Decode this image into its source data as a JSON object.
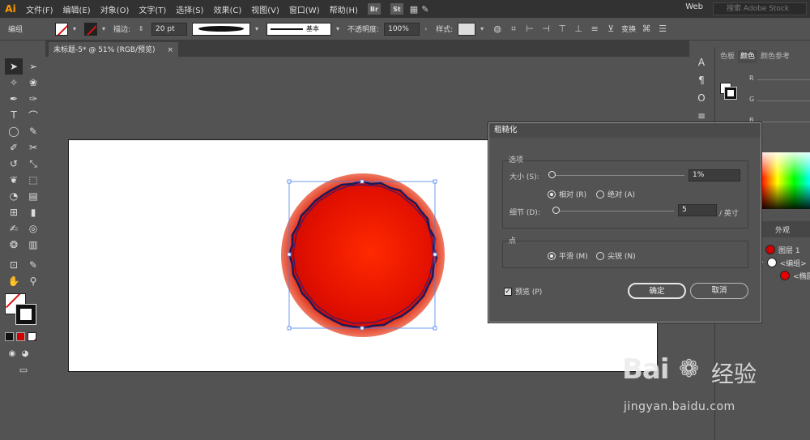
{
  "app": {
    "logo": "Ai"
  },
  "menu": [
    "文件(F)",
    "编辑(E)",
    "对象(O)",
    "文字(T)",
    "选择(S)",
    "效果(C)",
    "视图(V)",
    "窗口(W)",
    "帮助(H)"
  ],
  "menu_badges": [
    "Br",
    "St"
  ],
  "workspace": "Web",
  "search_placeholder": "搜索 Adobe Stock",
  "control": {
    "selection_label": "编组",
    "stroke_label": "描边:",
    "stroke_value": "20 pt",
    "profile_label": "基本",
    "opacity_label": "不透明度:",
    "opacity_value": "100%",
    "style_label": "样式:",
    "transform_label": "变换"
  },
  "document_tab": {
    "title": "未标题-5* @ 51% (RGB/预览)",
    "close": "×"
  },
  "color_panel": {
    "tabs": [
      "色板",
      "颜色",
      "颜色参考"
    ],
    "active_tab": "颜色",
    "sliders": [
      "R",
      "G",
      "B"
    ]
  },
  "layers_panel": {
    "tab": "外观",
    "rows": [
      {
        "name": "图层 1"
      },
      {
        "name": "<编组>"
      },
      {
        "name": "<椭圆>"
      }
    ]
  },
  "dialog": {
    "title": "粗糙化",
    "options_group": "选项",
    "size_label": "大小 (S):",
    "size_value": "1%",
    "size_fraction": 0.01,
    "relative_label": "相对 (R)",
    "absolute_label": "绝对 (A)",
    "detail_label": "细节 (D):",
    "detail_value": "5",
    "detail_unit": "/ 英寸",
    "points_group": "点",
    "smooth_label": "平滑 (M)",
    "corner_label": "尖锐 (N)",
    "preview_label": "预览 (P)",
    "ok_label": "确定",
    "cancel_label": "取消"
  },
  "watermark": {
    "brand": "Bai",
    "brand2": "经验",
    "url": "jingyan.baidu.com"
  },
  "colors": {
    "accent_red": "#ff2a00",
    "dialog_bg": "#535353",
    "panel_dark": "#323232"
  }
}
